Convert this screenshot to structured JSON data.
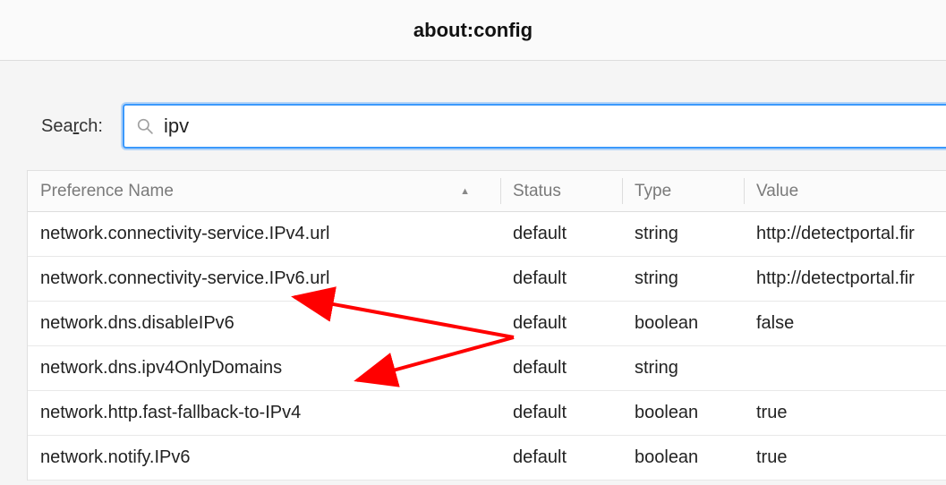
{
  "title": "about:config",
  "search": {
    "label_prefix": "Sea",
    "label_underlined": "r",
    "label_suffix": "ch:",
    "value": "ipv",
    "placeholder": ""
  },
  "columns": {
    "name": "Preference Name",
    "status": "Status",
    "type": "Type",
    "value": "Value"
  },
  "rows": [
    {
      "name": "network.connectivity-service.IPv4.url",
      "status": "default",
      "type": "string",
      "value": "http://detectportal.fir"
    },
    {
      "name": "network.connectivity-service.IPv6.url",
      "status": "default",
      "type": "string",
      "value": "http://detectportal.fir"
    },
    {
      "name": "network.dns.disableIPv6",
      "status": "default",
      "type": "boolean",
      "value": "false"
    },
    {
      "name": "network.dns.ipv4OnlyDomains",
      "status": "default",
      "type": "string",
      "value": ""
    },
    {
      "name": "network.http.fast-fallback-to-IPv4",
      "status": "default",
      "type": "boolean",
      "value": "true"
    },
    {
      "name": "network.notify.IPv6",
      "status": "default",
      "type": "boolean",
      "value": "true"
    }
  ],
  "sort_indicator": "▲"
}
